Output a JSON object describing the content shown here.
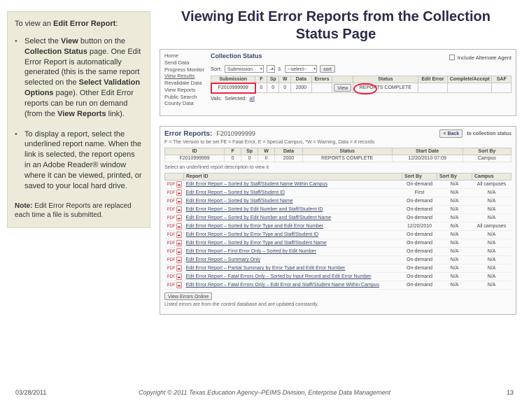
{
  "title": "Viewing Edit Error Reports from the Collection Status Page",
  "sidebar": {
    "intro_pre": "To view an ",
    "intro_bold": "Edit Error Report",
    "intro_post": ":",
    "bullets": [
      {
        "parts": [
          {
            "t": "Select the "
          },
          {
            "t": "View",
            "b": true
          },
          {
            "t": " button on the "
          },
          {
            "t": "Collection Status",
            "b": true
          },
          {
            "t": " page. One Edit Error Report is automatically generated (this is the same report selected on the "
          },
          {
            "t": "Select Validation Options",
            "b": true
          },
          {
            "t": " page). Other Edit Error reports can be run on demand (from the "
          },
          {
            "t": "View Reports",
            "b": true
          },
          {
            "t": " link)."
          }
        ]
      },
      {
        "parts": [
          {
            "t": "To display a report, select the underlined report name. When the link is selected, the report opens in an Adobe Reader® window where it can be viewed, printed, or saved to your local hard drive."
          }
        ]
      }
    ],
    "note_label": "Note:",
    "note_text": " Edit Error Reports are replaced each time a file is submitted."
  },
  "collection_status": {
    "title": "Collection Status",
    "include_label": "Include Alternate Agent",
    "include_checked": false,
    "leftnav": [
      "Home",
      "Send Data",
      "Progress Monitor",
      "View Results",
      "Revalidate Data",
      "",
      "View Reports",
      "Public Search",
      "County Data"
    ],
    "leftnav_active": 3,
    "sort_label": "Sort:",
    "sort_sel1": "Submission",
    "sort_sel2": "—",
    "sort_sel3_lbl": "3. ",
    "sort_sel3": "--select--",
    "sort_btn": "sort",
    "headers": [
      "Submission",
      "F",
      "Sp",
      "W",
      "Data",
      "Errors",
      "",
      "Status",
      "Edit Error",
      "Complete/Accept",
      "SAF"
    ],
    "row": {
      "submission": "F2010999999",
      "F": "0",
      "Sp": "0",
      "W": "0",
      "Data": "2000",
      "Errors": "",
      "view": "View",
      "Status": "REPORTS COMPLETE",
      "EditError": "",
      "CompleteAccept": "",
      "SAF": ""
    },
    "vals_row_label": "Vals:",
    "vals_selected": "Selected:",
    "vals_all": "all"
  },
  "error_reports": {
    "heading": "Error Reports:",
    "id": "F2010999999",
    "back_btn": "< Back",
    "back_text": "to collection status",
    "legend": "F = The Version to be set  FE = Fatal Error,  E = Special Campus,  *W = Warning, Data = # records",
    "headers": [
      "ID",
      "F",
      "Sp",
      "W",
      "Data",
      "Status",
      "Start Date",
      "Sort By"
    ],
    "row": {
      "ID": "F2010999999",
      "F": "0",
      "Sp": "0",
      "W": "II",
      "Data": "2000",
      "Status": "REPORTS COMPLETE",
      "StartDate": "12/20/2010 07:09",
      "SortBy": "Campus"
    },
    "select_hint": "Select an underlined report description to view it",
    "list_headers": [
      "",
      "Report ID",
      "",
      "Sort By",
      "Sort By",
      "Campus"
    ],
    "reports": [
      {
        "name": "Edit Error Report – Sorted by Staff/Student Name Within Campus",
        "sort1": "On-demand",
        "sort2": "N/A",
        "campus": "All campuses"
      },
      {
        "name": "Edit Error Report – Sorted by Staff/Student ID",
        "sort1": "First",
        "sort2": "N/A",
        "campus": "N/A"
      },
      {
        "name": "Edit Error Report – Sorted by Staff/Student Name",
        "sort1": "On-demand",
        "sort2": "N/A",
        "campus": "N/A"
      },
      {
        "name": "Edit Error Report – Sorted by Edit Number and Staff/Student ID",
        "sort1": "On-demand",
        "sort2": "N/A",
        "campus": "N/A"
      },
      {
        "name": "Edit Error Report – Sorted by Edit Number and Staff/Student Name",
        "sort1": "On-demand",
        "sort2": "N/A",
        "campus": "N/A"
      },
      {
        "name": "Edit Error Report – Sorted by Error Type and Edit Error Number",
        "sort1": "12/20/2010",
        "sort2": "N/A",
        "campus": "All campuses"
      },
      {
        "name": "Edit Error Report – Sorted by Error Type and Staff/Student ID",
        "sort1": "On-demand",
        "sort2": "N/A",
        "campus": "N/A"
      },
      {
        "name": "Edit Error Report – Sorted by Error Type and Staff/Student Name",
        "sort1": "On-demand",
        "sort2": "N/A",
        "campus": "N/A"
      },
      {
        "name": "Edit Error Report – First Error Only – Sorted by Edit Number",
        "sort1": "On-demand",
        "sort2": "N/A",
        "campus": "N/A"
      },
      {
        "name": "Edit Error Report – Summary Only",
        "sort1": "On-demand",
        "sort2": "N/A",
        "campus": "N/A"
      },
      {
        "name": "Edit Error Report – Partial Summary by Error Type and Edit Error Number",
        "sort1": "On-demand",
        "sort2": "N/A",
        "campus": "N/A"
      },
      {
        "name": "Edit Error Report – Fatal Errors Only – Sorted by Input Record and Edit Error Number",
        "sort1": "On-demand",
        "sort2": "N/A",
        "campus": "N/A"
      },
      {
        "name": "Edit Error Report – Fatal Errors Only – Edit Error and Staff/Student Name Within Campus",
        "sort1": "On-demand",
        "sort2": "N/A",
        "campus": "N/A"
      }
    ],
    "more_btn": "View Errors Online",
    "footer_hint": "Listed errors are from the control database and are updated constantly."
  },
  "footer": {
    "date": "03/28/2011",
    "copyright": "Copyright © 2011 Texas Education Agency–PEIMS Division, Enterprise Data Management",
    "page": "13"
  }
}
